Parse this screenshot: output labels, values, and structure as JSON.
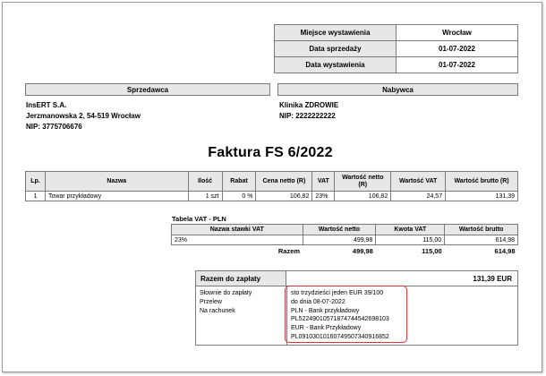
{
  "meta": [
    {
      "label": "Miejsce wystawienia",
      "value": "Wrocław"
    },
    {
      "label": "Data sprzedaży",
      "value": "01-07-2022"
    },
    {
      "label": "Data wystawienia",
      "value": "01-07-2022"
    }
  ],
  "seller": {
    "header": "Sprzedawca",
    "name": "InsERT S.A.",
    "address": "Jerzmanowska 2, 54-519 Wrocław",
    "nip": "NIP: 3775706676"
  },
  "buyer": {
    "header": "Nabywca",
    "name": "Klinika ZDROWIE",
    "nip": "NIP: 2222222222"
  },
  "title": "Faktura FS 6/2022",
  "items_table": {
    "headers": {
      "lp": "Lp.",
      "name": "Nazwa",
      "qty": "Ilość",
      "discount": "Rabat",
      "net_price": "Cena netto (R)",
      "vat": "VAT",
      "net_value": "Wartość netto (R)",
      "vat_value": "Wartość VAT",
      "gross_value": "Wartość brutto (R)"
    },
    "rows": [
      {
        "lp": "1",
        "name": "Towar przykładowy",
        "qty": "1 szt",
        "discount": "0 %",
        "net_price": "106,82",
        "vat": "23%",
        "net_value": "106,82",
        "vat_value": "24,57",
        "gross_value": "131,39"
      }
    ]
  },
  "vat_table": {
    "caption": "Tabela VAT - PLN",
    "headers": {
      "rate": "Nazwa stawki VAT",
      "net": "Wartość netto",
      "tax": "Kwota VAT",
      "gross": "Wartość brutto"
    },
    "rows": [
      {
        "rate": "23%",
        "net": "499,98",
        "tax": "115,00",
        "gross": "614,98"
      }
    ],
    "sum": {
      "label": "Razem",
      "net": "499,98",
      "tax": "115,00",
      "gross": "614,98"
    }
  },
  "payment": {
    "label": "Razem do zapłaty",
    "amount": "131,39 EUR",
    "labels": [
      "Słownie do zapłaty",
      "Przelew",
      "Na rachunek"
    ],
    "details": [
      "sto trzydzieści jeden EUR 39/100",
      "do dnia 08-07-2022",
      "PLN - Bank przykładowy",
      "PL52249010571874744542698103",
      "EUR - Bank Przykładowy",
      "PL09103010160749507340916852"
    ]
  },
  "colors": {
    "header_bg": "#e7e7e7",
    "border": "#7a7a7a",
    "highlight": "#e0303a"
  }
}
